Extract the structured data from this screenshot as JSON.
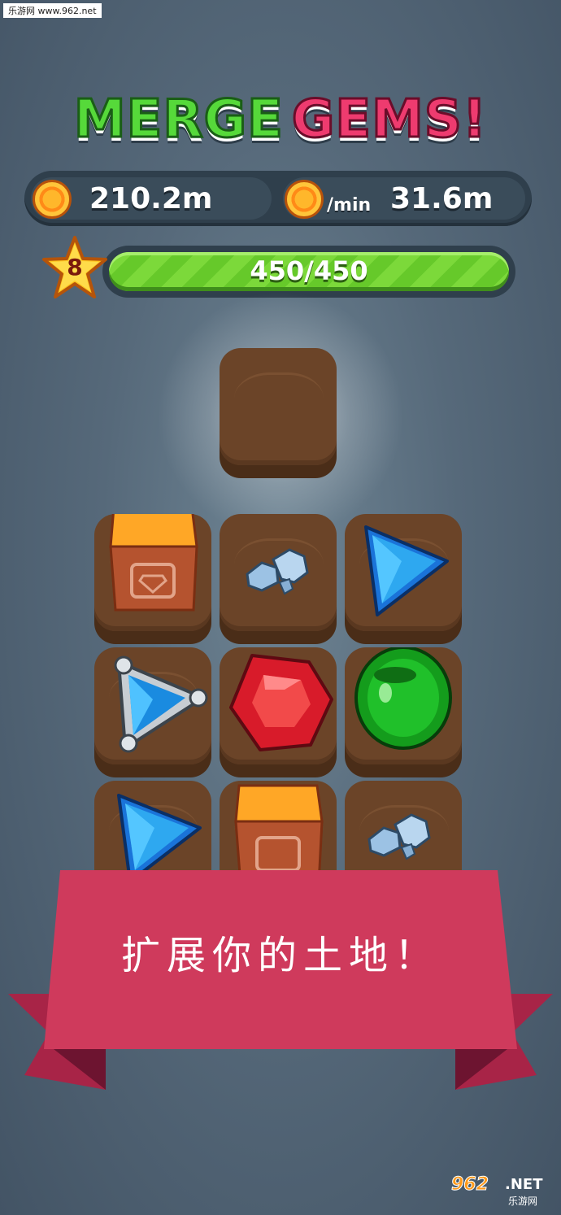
{
  "watermark_top": "乐游网 www.962.net",
  "title": {
    "word1": "MERGE",
    "word2": "GEMS!"
  },
  "stats": {
    "coins": "210.2m",
    "per_min_label": "/min",
    "income": "31.6m"
  },
  "level": {
    "number": "8",
    "xp_text": "450/450",
    "xp_progress": 1.0
  },
  "board": {
    "tiles": [
      {
        "row": 0,
        "col": 1,
        "item": "empty"
      },
      {
        "row": 1,
        "col": 0,
        "item": "gem-crate"
      },
      {
        "row": 1,
        "col": 1,
        "item": "rough-stones"
      },
      {
        "row": 1,
        "col": 2,
        "item": "blue-triangle-gem"
      },
      {
        "row": 2,
        "col": 0,
        "item": "silver-amulet-gem"
      },
      {
        "row": 2,
        "col": 1,
        "item": "red-ruby"
      },
      {
        "row": 2,
        "col": 2,
        "item": "green-emerald"
      },
      {
        "row": 3,
        "col": 0,
        "item": "blue-triangle-gem"
      },
      {
        "row": 3,
        "col": 1,
        "item": "gem-crate"
      },
      {
        "row": 3,
        "col": 2,
        "item": "rough-stones"
      }
    ]
  },
  "banner": {
    "text": "扩展你的土地！"
  },
  "watermark_bottom": {
    "logo": "962",
    "net": ".NET",
    "cn": "乐游网"
  },
  "colors": {
    "background": "#56697a",
    "merge_green": "#56d93a",
    "gems_pink": "#ee3b6f",
    "banner_red": "#cf3a5c",
    "tile_brown": "#6b4428"
  }
}
